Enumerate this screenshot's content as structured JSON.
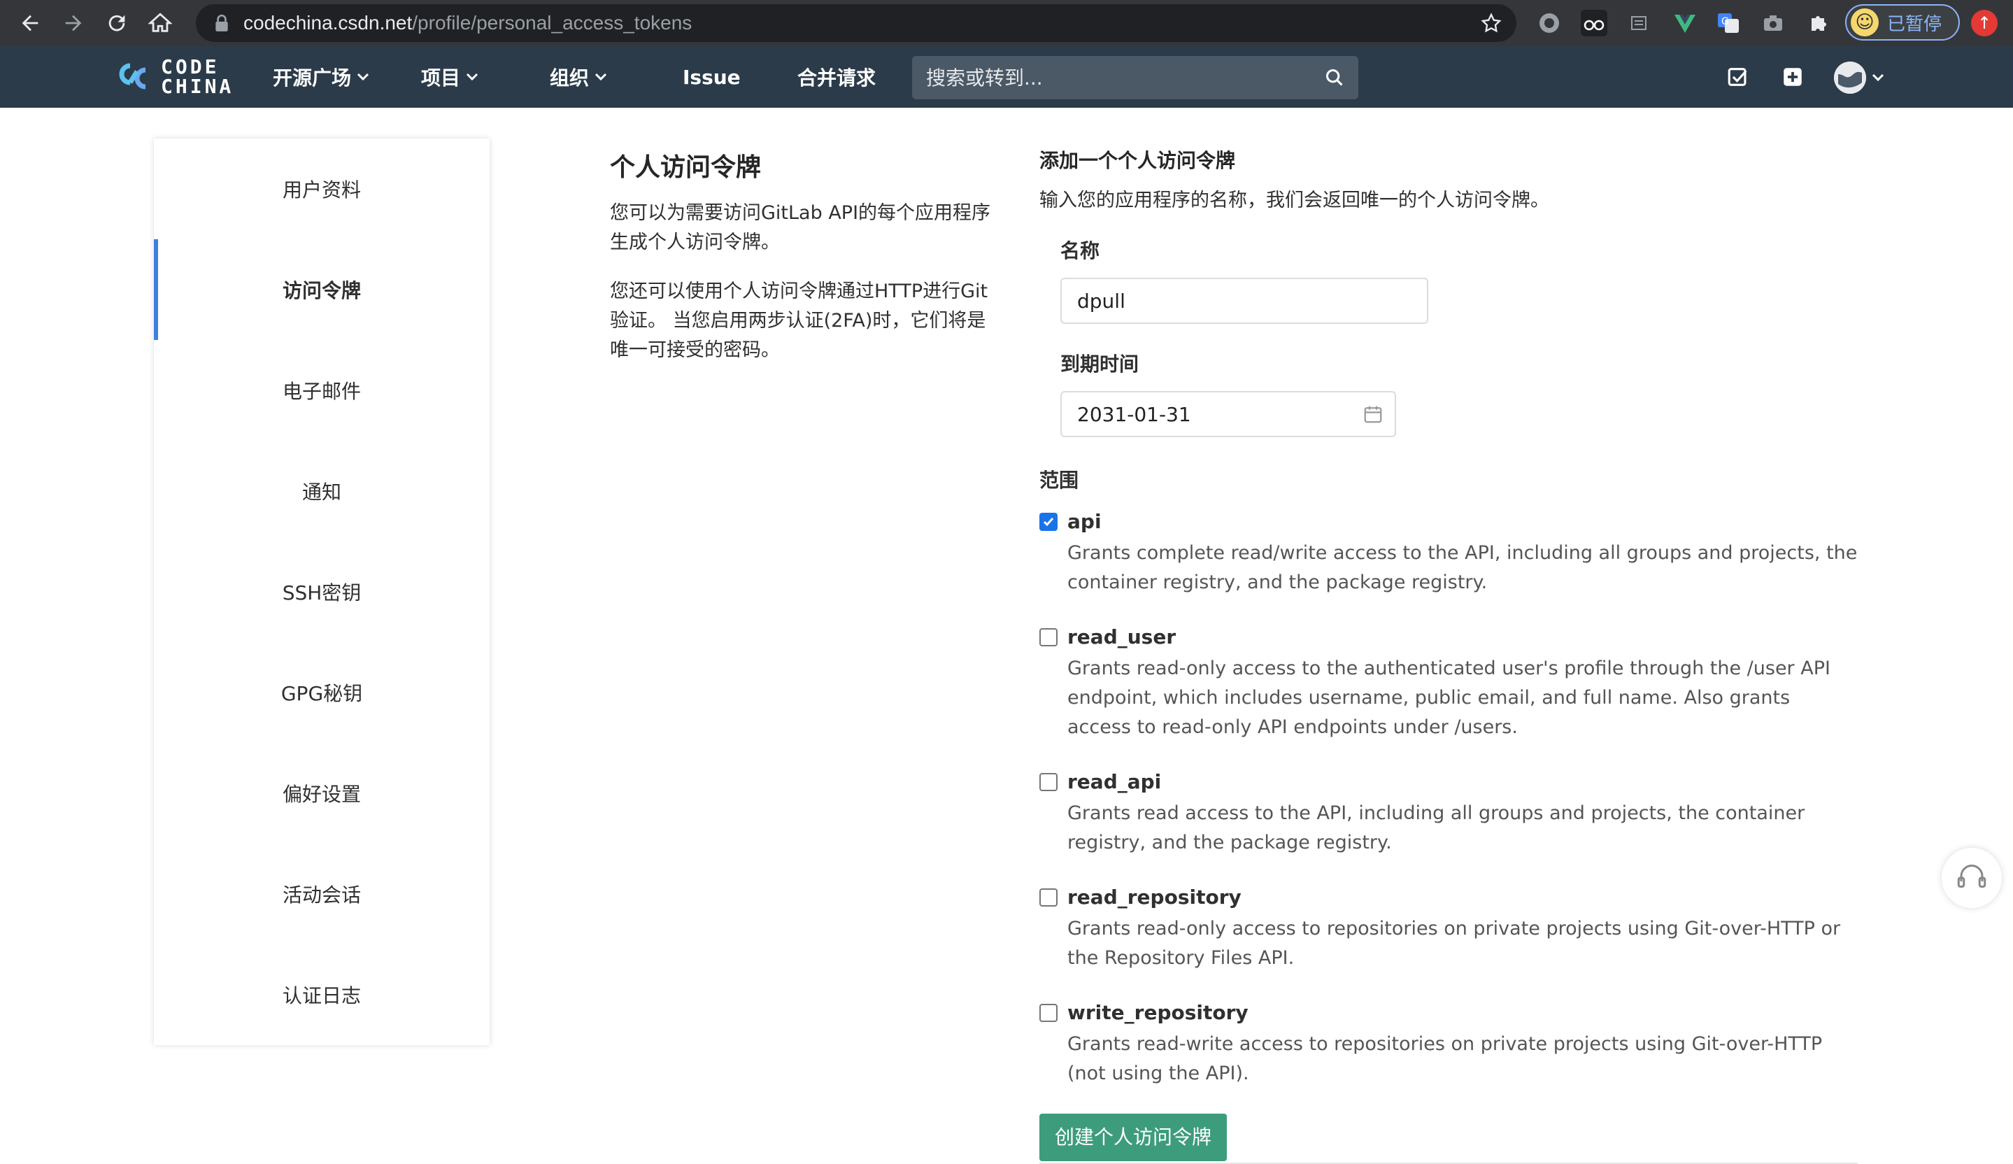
{
  "browser": {
    "url_host": "codechina.csdn.net",
    "url_path": "/profile/personal_access_tokens",
    "profile_status": "已暂停"
  },
  "header": {
    "logo_line1": "CODE",
    "logo_line2": "CHINA",
    "nav": [
      {
        "label": "开源广场",
        "dropdown": true
      },
      {
        "label": "项目",
        "dropdown": true
      },
      {
        "label": "组织",
        "dropdown": true
      },
      {
        "label": "Issue",
        "dropdown": false
      },
      {
        "label": "合并请求",
        "dropdown": false
      }
    ],
    "search_placeholder": "搜索或转到..."
  },
  "sidebar": {
    "items": [
      {
        "label": "用户资料",
        "active": false
      },
      {
        "label": "访问令牌",
        "active": true
      },
      {
        "label": "电子邮件",
        "active": false
      },
      {
        "label": "通知",
        "active": false
      },
      {
        "label": "SSH密钥",
        "active": false
      },
      {
        "label": "GPG秘钥",
        "active": false
      },
      {
        "label": "偏好设置",
        "active": false
      },
      {
        "label": "活动会话",
        "active": false
      },
      {
        "label": "认证日志",
        "active": false
      }
    ]
  },
  "info": {
    "title": "个人访问令牌",
    "para1": "您可以为需要访问GitLab API的每个应用程序生成个人访问令牌。",
    "para2": "您还可以使用个人访问令牌通过HTTP进行Git验证。 当您启用两步认证(2FA)时，它们将是唯一可接受的密码。"
  },
  "form": {
    "title": "添加一个个人访问令牌",
    "description": "输入您的应用程序的名称，我们会返回唯一的个人访问令牌。",
    "name_label": "名称",
    "name_value": "dpull",
    "expiry_label": "到期时间",
    "expiry_value": "2031-01-31",
    "scopes_label": "范围",
    "scopes": [
      {
        "name": "api",
        "checked": true,
        "description": "Grants complete read/write access to the API, including all groups and projects, the container registry, and the package registry."
      },
      {
        "name": "read_user",
        "checked": false,
        "description": "Grants read-only access to the authenticated user's profile through the /user API endpoint, which includes username, public email, and full name. Also grants access to read-only API endpoints under /users."
      },
      {
        "name": "read_api",
        "checked": false,
        "description": "Grants read access to the API, including all groups and projects, the container registry, and the package registry."
      },
      {
        "name": "read_repository",
        "checked": false,
        "description": "Grants read-only access to repositories on private projects using Git-over-HTTP or the Repository Files API."
      },
      {
        "name": "write_repository",
        "checked": false,
        "description": "Grants read-write access to repositories on private projects using Git-over-HTTP (not using the API)."
      }
    ],
    "submit_label": "创建个人访问令牌"
  },
  "colors": {
    "header_bg": "#2b3b4a",
    "accent_blue": "#3f7fe0",
    "submit_green": "#3d9c7c"
  }
}
